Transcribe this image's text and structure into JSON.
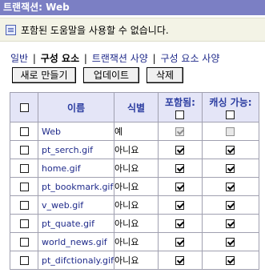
{
  "title": "트랜잭션: Web",
  "info": {
    "icon": "info-panel-icon",
    "text": "포함된 도움말을 사용할 수 없습니다."
  },
  "tabs": [
    {
      "label": "일반",
      "active": false
    },
    {
      "label": "구성 요소",
      "active": true
    },
    {
      "label": "트랜잭션 사양",
      "active": false
    },
    {
      "label": "구성 요소 사양",
      "active": false
    }
  ],
  "buttons": {
    "new_label": "새로 만들기",
    "update_label": "업데이트",
    "delete_label": "삭제"
  },
  "table": {
    "columns": {
      "name": "이름",
      "identify": "식별",
      "included": "포함됨:",
      "cacheable": "캐싱 가능:"
    },
    "rows": [
      {
        "name": "Web",
        "identify": "예",
        "selected": false,
        "included": true,
        "cacheable": false,
        "disabled": true
      },
      {
        "name": "pt_serch.gif",
        "identify": "아니요",
        "selected": false,
        "included": true,
        "cacheable": true,
        "disabled": false
      },
      {
        "name": "home.gif",
        "identify": "아니요",
        "selected": false,
        "included": true,
        "cacheable": true,
        "disabled": false
      },
      {
        "name": "pt_bookmark.gif",
        "identify": "아니요",
        "selected": false,
        "included": true,
        "cacheable": true,
        "disabled": false
      },
      {
        "name": "v_web.gif",
        "identify": "아니요",
        "selected": false,
        "included": true,
        "cacheable": true,
        "disabled": false
      },
      {
        "name": "pt_quate.gif",
        "identify": "아니요",
        "selected": false,
        "included": true,
        "cacheable": true,
        "disabled": false
      },
      {
        "name": "world_news.gif",
        "identify": "아니요",
        "selected": false,
        "included": true,
        "cacheable": true,
        "disabled": false
      },
      {
        "name": "pt_difctionaly.gif",
        "identify": "아니요",
        "selected": false,
        "included": true,
        "cacheable": true,
        "disabled": false
      }
    ]
  }
}
